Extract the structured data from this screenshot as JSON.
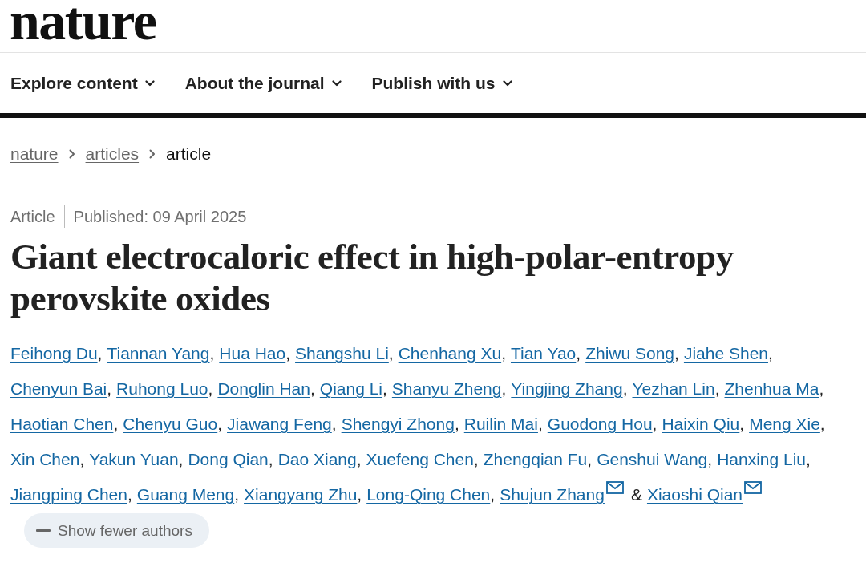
{
  "header": {
    "logo": "nature"
  },
  "nav": [
    {
      "label": "Explore content",
      "expanded": false
    },
    {
      "label": "About the journal",
      "expanded": false
    },
    {
      "label": "Publish with us",
      "expanded": false
    }
  ],
  "breadcrumb": [
    {
      "label": "nature",
      "current": false
    },
    {
      "label": "articles",
      "current": false
    },
    {
      "label": "article",
      "current": true
    }
  ],
  "article": {
    "type": "Article",
    "published": "Published: 09 April 2025",
    "title": "Giant electrocaloric effect in high-polar-entropy perovskite oxides",
    "authors": [
      {
        "name": "Feihong Du",
        "separator": ",",
        "corresponding": false
      },
      {
        "name": "Tiannan Yang",
        "separator": ",",
        "corresponding": false
      },
      {
        "name": "Hua Hao",
        "separator": ",",
        "corresponding": false
      },
      {
        "name": "Shangshu Li",
        "separator": ",",
        "corresponding": false
      },
      {
        "name": "Chenhang Xu",
        "separator": ",",
        "corresponding": false
      },
      {
        "name": "Tian Yao",
        "separator": ",",
        "corresponding": false
      },
      {
        "name": "Zhiwu Song",
        "separator": ",",
        "corresponding": false
      },
      {
        "name": "Jiahe Shen",
        "separator": ",",
        "corresponding": false
      },
      {
        "name": "Chenyun Bai",
        "separator": ",",
        "corresponding": false
      },
      {
        "name": "Ruhong Luo",
        "separator": ",",
        "corresponding": false
      },
      {
        "name": "Donglin Han",
        "separator": ",",
        "corresponding": false
      },
      {
        "name": "Qiang Li",
        "separator": ",",
        "corresponding": false
      },
      {
        "name": "Shanyu Zheng",
        "separator": ",",
        "corresponding": false
      },
      {
        "name": "Yingjing Zhang",
        "separator": ",",
        "corresponding": false
      },
      {
        "name": "Yezhan Lin",
        "separator": ",",
        "corresponding": false
      },
      {
        "name": "Zhenhua Ma",
        "separator": ",",
        "corresponding": false
      },
      {
        "name": "Haotian Chen",
        "separator": ",",
        "corresponding": false
      },
      {
        "name": "Chenyu Guo",
        "separator": ",",
        "corresponding": false
      },
      {
        "name": "Jiawang Feng",
        "separator": ",",
        "corresponding": false
      },
      {
        "name": "Shengyi Zhong",
        "separator": ",",
        "corresponding": false
      },
      {
        "name": "Ruilin Mai",
        "separator": ",",
        "corresponding": false
      },
      {
        "name": "Guodong Hou",
        "separator": ",",
        "corresponding": false
      },
      {
        "name": "Haixin Qiu",
        "separator": ",",
        "corresponding": false
      },
      {
        "name": "Meng Xie",
        "separator": ",",
        "corresponding": false
      },
      {
        "name": "Xin Chen",
        "separator": ",",
        "corresponding": false
      },
      {
        "name": "Yakun Yuan",
        "separator": ",",
        "corresponding": false
      },
      {
        "name": "Dong Qian",
        "separator": ",",
        "corresponding": false
      },
      {
        "name": "Dao Xiang",
        "separator": ",",
        "corresponding": false
      },
      {
        "name": "Xuefeng Chen",
        "separator": ",",
        "corresponding": false
      },
      {
        "name": "Zhengqian Fu",
        "separator": ",",
        "corresponding": false
      },
      {
        "name": "Genshui Wang",
        "separator": ",",
        "corresponding": false
      },
      {
        "name": "Hanxing Liu",
        "separator": ",",
        "corresponding": false
      },
      {
        "name": "Jiangping Chen",
        "separator": ",",
        "corresponding": false
      },
      {
        "name": "Guang Meng",
        "separator": ",",
        "corresponding": false
      },
      {
        "name": "Xiangyang Zhu",
        "separator": ",",
        "corresponding": false
      },
      {
        "name": "Long-Qing Chen",
        "separator": ",",
        "corresponding": false
      },
      {
        "name": "Shujun Zhang",
        "separator": "&",
        "corresponding": true
      },
      {
        "name": "Xiaoshi Qian",
        "corresponding": true
      }
    ],
    "show_fewer_button": {
      "label": "Show fewer authors",
      "expanded": true
    }
  }
}
